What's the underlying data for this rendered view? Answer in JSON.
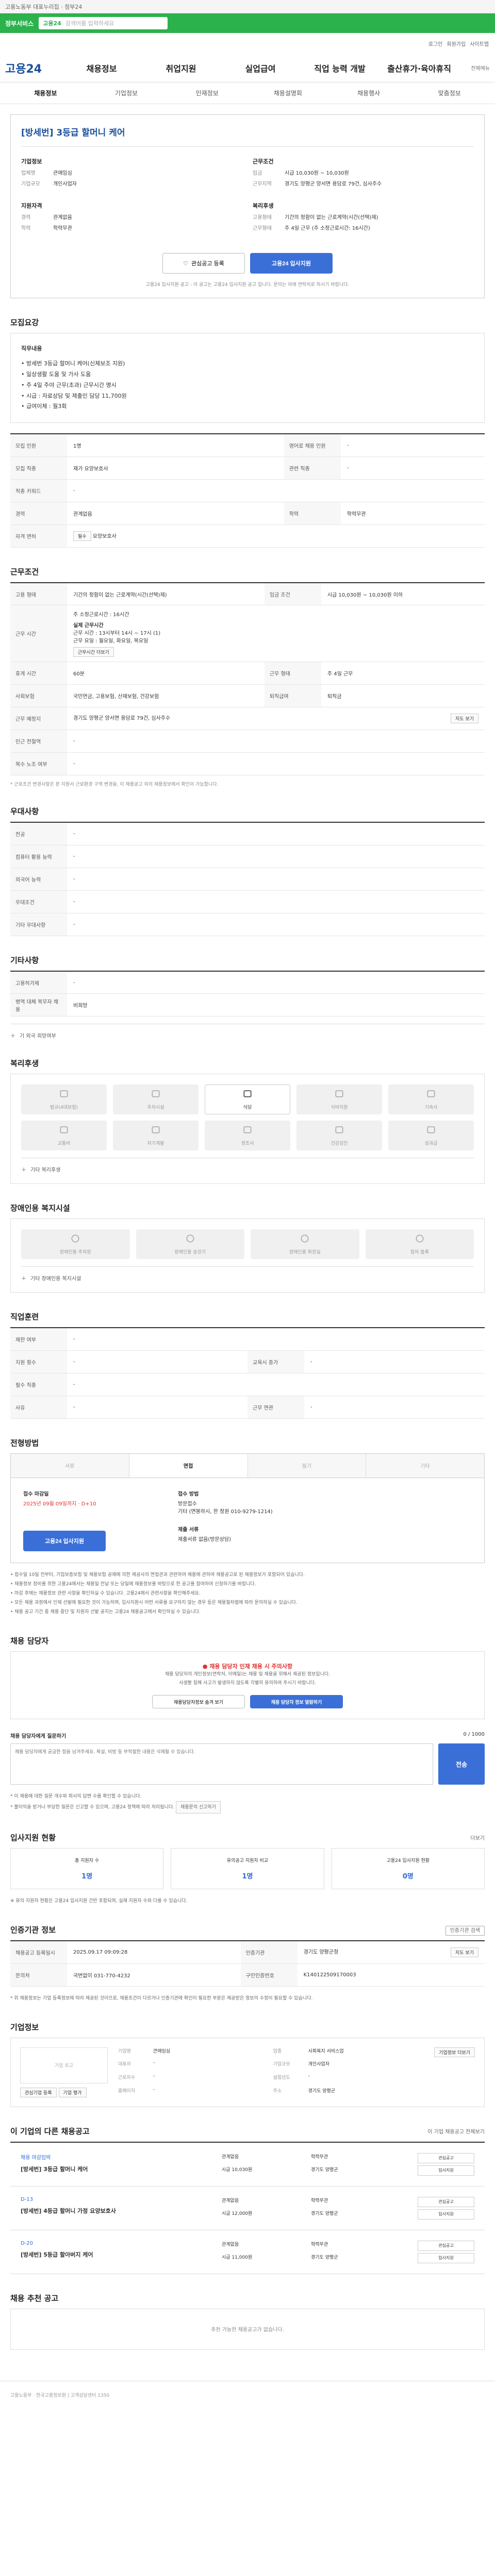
{
  "top": {
    "text": "고용노동부 대표누리집 · 정부24"
  },
  "green": {
    "logo": "정부서비스",
    "label": "고용24",
    "search_placeholder": "검색어를 입력하세요"
  },
  "subbar": {
    "items": [
      "로그인",
      "회원가입",
      "사이트맵"
    ]
  },
  "mainnav": {
    "brand": "고용24",
    "items": [
      "채용정보",
      "취업지원",
      "실업급여",
      "직업 능력 개발",
      "출산휴가·육아휴직"
    ],
    "util": "전체메뉴"
  },
  "subnav": {
    "items": [
      "채용정보",
      "기업정보",
      "인재정보",
      "채용설명회",
      "채용행사",
      "맞춤정보"
    ]
  },
  "job": {
    "title": "[방세번] 3등급 할머니 케어",
    "left_label": "기업정보",
    "right_label": "근무조건",
    "company": [
      {
        "k": "업체명",
        "v": "큰애임심"
      },
      {
        "k": "기업규모",
        "v": "개인사업자"
      }
    ],
    "cond": [
      {
        "k": "임금",
        "v": "시급 10,030원 ~ 10,030원"
      },
      {
        "k": "근무지역",
        "v": "경기도 양평군 양서면 용담로 79건, 심사주수"
      }
    ],
    "left_label2": "지원자격",
    "right_label2": "복리후생",
    "qual": [
      {
        "k": "경력",
        "v": "관계없음"
      },
      {
        "k": "학력",
        "v": "학력무관"
      }
    ],
    "welfare": [
      {
        "k": "고용형태",
        "v": "기간의 정함이 없는 근로계약(시간(선택)제)"
      },
      {
        "k": "근무형태",
        "v": "주 4일 근무 (주 소정근로시간: 16시간)"
      }
    ],
    "btn_save": "관심공고 등록",
    "btn_apply": "고용24 입사지원",
    "note": "고용24 입사지원 공고 : 이 공고는 고용24 입사지원 공고 입니다. 문의는 아래 연락처로 하시기 바랍니다."
  },
  "recruit": {
    "title": "모집요강",
    "sub": "직무내용",
    "desc": [
      "• 방세번 3등급 할머니 케어(신체보조 지원)",
      "• 일상생활 도움 및 가사 도움",
      "• 주 4일 주야 근무(초과) 근무시간 명시",
      "• 시급 : 자료상담 및 제출인 담당 11,700원",
      "• 급여이체 : 월3회"
    ],
    "rows": [
      {
        "k": "모집 인원",
        "v": "1명",
        "k2": "영어로 채용 인원",
        "v2": "-"
      },
      {
        "k": "모집 직종",
        "v": "재가 요양보호사",
        "k2": "관련 직종",
        "v2": "-"
      },
      {
        "k": "직종 키워드",
        "v": "-",
        "k2": "",
        "v2": ""
      },
      {
        "k": "경력",
        "v": "관계없음",
        "k2": "학력",
        "v2": "학력무관"
      },
      {
        "k": "자격 면허",
        "v": "요양보호사",
        "k2": "",
        "v2": ""
      }
    ],
    "lic_tag": "필수"
  },
  "work": {
    "title": "근무조건",
    "rows": [
      {
        "k": "고용 형태",
        "v": "기간의 정함이 없는 근로계약(시간(선택)제)",
        "k2": "임금 조건",
        "v2": "시급 10,030원 ~ 10,030원 이하"
      },
      {
        "k": "근무 시간",
        "v": "주 소정근로시간 : 16시간",
        "k2": "",
        "v2": ""
      },
      {
        "k": "휴게 시간",
        "v": "60분",
        "k2": "근무 형태",
        "v2": "주 4일 근무"
      },
      {
        "k": "사회보험",
        "v": "국민연금, 고용보험, 산재보험, 건강보험",
        "k2": "퇴직급여",
        "v2": "퇴직금"
      },
      {
        "k": "근무 예정지",
        "v": "경기도 양평군 양서면 용담로 79건, 심사주수",
        "k2": "",
        "v2": ""
      },
      {
        "k": "인근 전철역",
        "v": "-",
        "k2": "",
        "v2": ""
      },
      {
        "k": "복수 노조 여부",
        "v": "-",
        "k2": "",
        "v2": ""
      }
    ],
    "time_label": "실제 근무시간",
    "time_lines": [
      "근무 시간 : 13시부터 14시 ~ 17시 (1)",
      "근무 요일 : 월요일, 화요일, 목요일"
    ],
    "time_more": "근무시간 더보기",
    "map_btn": "지도 보기",
    "note": "* 근로조건 변경사항은 본 지원서 근로환경 구역 변경을, 이 채용공고 외의 채용정보에서 확인이 가능합니다."
  },
  "pref": {
    "title": "우대사항",
    "rows": [
      {
        "k": "전공",
        "v": "-"
      },
      {
        "k": "컴퓨터 활용 능력",
        "v": "-"
      },
      {
        "k": "외국어 능력",
        "v": "-"
      },
      {
        "k": "우대조건",
        "v": "-"
      },
      {
        "k": "기타 우대사항",
        "v": "-"
      }
    ]
  },
  "etc": {
    "title": "기타사항",
    "rows": [
      {
        "k": "고용허가제",
        "v": "-"
      },
      {
        "k": "병역 대체 복무자 채용",
        "v": "비희망"
      }
    ],
    "acc": "기 외국 희망여부"
  },
  "benefit": {
    "title": "복리후생",
    "items": [
      "법규(4대보험)",
      "주차시설",
      "식당",
      "식비지원",
      "기숙사",
      "교통비",
      "자기계발",
      "경조사",
      "건강검진",
      "성과급"
    ],
    "active_index": 2,
    "acc": "기타 복리후생"
  },
  "disab": {
    "title": "장애인용 복지시설",
    "items": [
      "장애인용 주차장",
      "장애인용 승강기",
      "장애인용 화장실",
      "점자 블록"
    ],
    "acc": "기타 장애인용 복지시설"
  },
  "edu": {
    "title": "직업훈련",
    "rows": [
      {
        "k": "제한 여부",
        "v": "-"
      },
      {
        "k": "지원 횟수",
        "v": "-",
        "k2": "교육시 증가",
        "v2": "-"
      },
      {
        "k": "필수 직종",
        "v": "-",
        "k2": "",
        "v2": ""
      },
      {
        "k": "사유",
        "v": "-",
        "k2": "근무 연관",
        "v2": "-"
      }
    ]
  },
  "process": {
    "title": "전형방법",
    "steps": [
      "서류",
      "면접",
      "필기",
      "기타"
    ],
    "active": 1,
    "deadline_label": "접수 마감일",
    "deadline": "2025년 09월 09일까지 · D+10",
    "method_label": "접수 방법",
    "method": "방문접수",
    "contact": "기타 (면봉하시, 한 정원 010-9279-1214)",
    "files_label": "제출 서류",
    "files": "제출서류 없음(방문상담)",
    "apply_btn": "고용24 입사지원",
    "bullets": [
      "• 접수일 10일 전부터, 기업보증보험 및 채용보험 공제에 의한 제공사의 면접관과 관련하여 채용에 관하여 채용공고로 된 채용정보가 포함되어 있습니다.",
      "• 채용정보 장비를 위한 고용24에서는 채용일 전날 또는 당일에 채용정보를 바탕으로 한 공고를 참여하여 신청하기를 바랍니다.",
      "• 마감 후에는 채용정보 관련 사항을 확인하실 수 있습니다. 고용24에서 관련사항을 확인해주세요.",
      "• 모든 채용 과정에서 인재 선발에 필요한 것이 가능하며, 입사지원시 어떤 서류를 요구하지 않는 경우 등은 채용절차법에 따라 문의하실 수 있습니다.",
      "• 채용 공고 기간 중 채용 중단 및 지원자 선발 공지는 고용24 채용공고에서 확인하실 수 있습니다."
    ]
  },
  "safe": {
    "title": "채용 담당자",
    "warn": "채용 담당자 인재 채용 시 주의사항",
    "lines": [
      "채용 담당자의 개인정보(연락처, 이메일)는 채용 및 채용을 위해서 제공된 정보입니다.",
      "사생활 침해 사고가 발생하지 않도록 각별히 유의하여 주시기 바랍니다."
    ],
    "btn1": "채용담당자정보 숨겨 보기",
    "btn2": "채용 담당자 정보 열람하기"
  },
  "qa": {
    "label": "채용 담당자에게 질문하기",
    "counter": "0 / 1000",
    "placeholder": "채용 담당자에게 궁금한 점을 남겨주세요. 욕설, 비방 등 부적절한 내용은 삭제될 수 있습니다.",
    "btn": "전송",
    "note1": "* 이 채용에 대한 질문 개수와 회사의 답변 수를 확인할 수 있습니다.",
    "note2": "* 불이익을 받거나 부당한 질문은 신고할 수 있으며, 고용24 정책에 따라 처리됩니다.",
    "report_btn": "채용문의 신고하기"
  },
  "stats": {
    "title": "입사지원 현황",
    "more": "더보기",
    "items": [
      {
        "k": "총 지원자 수",
        "v": "1명"
      },
      {
        "k": "유의공고 지원자 비교",
        "v": "1명"
      },
      {
        "k": "고용24 입사지원 현황",
        "v": "0명"
      }
    ],
    "note": "※ 유의 지원자 현황은 고용24 입사지원 건만 포함되며, 실제 지원자 수와 다를 수 있습니다."
  },
  "regi": {
    "title": "인증기관 정보",
    "btn": "인증기관 검색",
    "rows": [
      {
        "k": "채용공고 등록일시",
        "v": "2025.09.17 09:09:28",
        "k2": "인증기관",
        "v2": "경기도 양평군청"
      },
      {
        "k": "문의처",
        "v": "국번없이 031-770-4232",
        "k2": "구인인증번호",
        "v2": "K140122509170003"
      }
    ],
    "map_btn": "지도 보기",
    "note": "* 위 채용정보는 기업 등록정보에 따라 제공된 것이므로, 채용조건이 다르거나 인증기관에 확인이 필요한 부분은 제공받은 정보의 수정이 필요할 수 있습니다."
  },
  "company": {
    "title": "기업정보",
    "logo": "기업 로고",
    "btn1": "관심기업 등록",
    "btn2": "기업 평가",
    "fields": [
      {
        "k": "기업명",
        "v": "큰애임심"
      },
      {
        "k": "업종",
        "v": "사회복지 서비스업"
      },
      {
        "k": "대표자",
        "v": "-"
      },
      {
        "k": "기업규모",
        "v": "개인사업자"
      },
      {
        "k": "근로자수",
        "v": "-"
      },
      {
        "k": "설립년도",
        "v": "-"
      },
      {
        "k": "홈페이지",
        "v": "-"
      },
      {
        "k": "주소",
        "v": "경기도 양평군"
      }
    ],
    "more": "기업정보 더보기"
  },
  "others": {
    "title": "이 기업의 다른 채용공고",
    "more": "이 기업 채용공고 전체보기",
    "items": [
      {
        "c": "채용 마감임박",
        "t": "[방세번] 3등급 할머니 케어",
        "a": [
          "관계없음",
          "학력무관",
          "시급 10,030원",
          "경기도 양평군"
        ],
        "badges": [
          "관심공고",
          "입사지원"
        ]
      },
      {
        "c": "D-13",
        "t": "[방세번] 4등급 할머니 가정 요양보호사",
        "a": [
          "관계없음",
          "학력무관",
          "시급 12,000원",
          "경기도 양평군"
        ],
        "badges": [
          "관심공고",
          "입사지원"
        ]
      },
      {
        "c": "D-20",
        "t": "[방세번] 5등급 할아버지 케어",
        "a": [
          "관계없음",
          "학력무관",
          "시급 11,000원",
          "경기도 양평군"
        ],
        "badges": [
          "관심공고",
          "입사지원"
        ]
      }
    ]
  },
  "reco": {
    "title": "채용 추천 공고",
    "text": "추천 가능한 채용공고가 없습니다."
  },
  "footer": {
    "text": "고용노동부 · 한국고용정보원 | 고객상담센터 1350"
  }
}
